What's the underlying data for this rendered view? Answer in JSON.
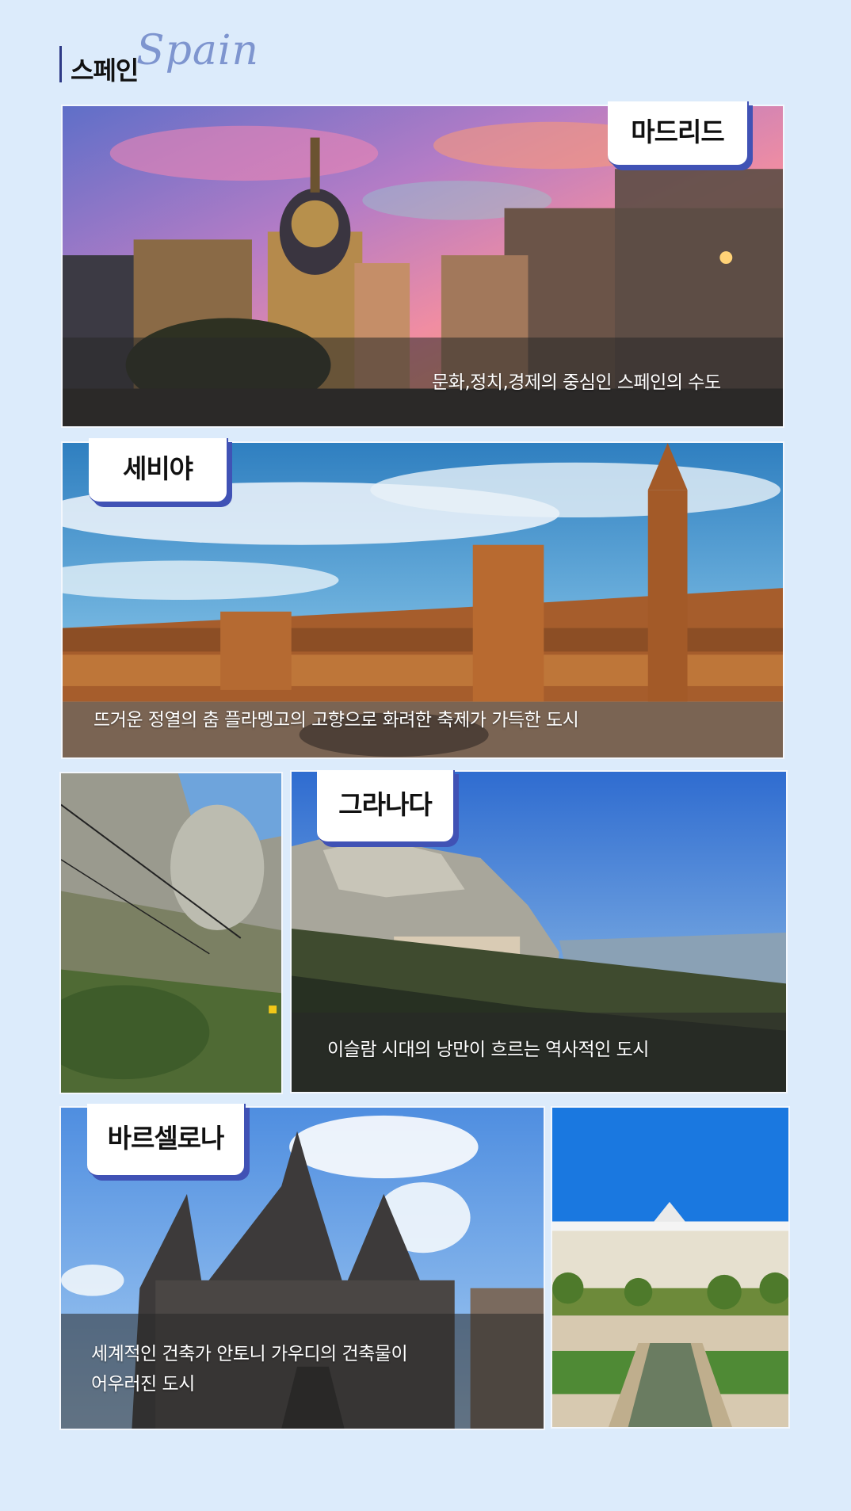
{
  "header": {
    "title": "스페인",
    "script": "Spain"
  },
  "cities": {
    "madrid": {
      "name": "마드리드",
      "caption": "문화,정치,경제의 중심인 스페인의 수도"
    },
    "seville": {
      "name": "세비야",
      "caption": "뜨거운 정열의 춤 플라멩고의 고향으로 화려한 축제가 가득한 도시"
    },
    "granada": {
      "name": "그라나다",
      "caption": "이슬람 시대의 낭만이 흐르는 역사적인 도시"
    },
    "barcelona": {
      "name": "바르셀로나",
      "caption_line1": "세계적인 건축가 안토니 가우디의 건축물이",
      "caption_line2": "어우러진 도시"
    }
  },
  "colors": {
    "background": "#dcebfb",
    "accent": "#4052b5",
    "script": "#7e95cf"
  }
}
